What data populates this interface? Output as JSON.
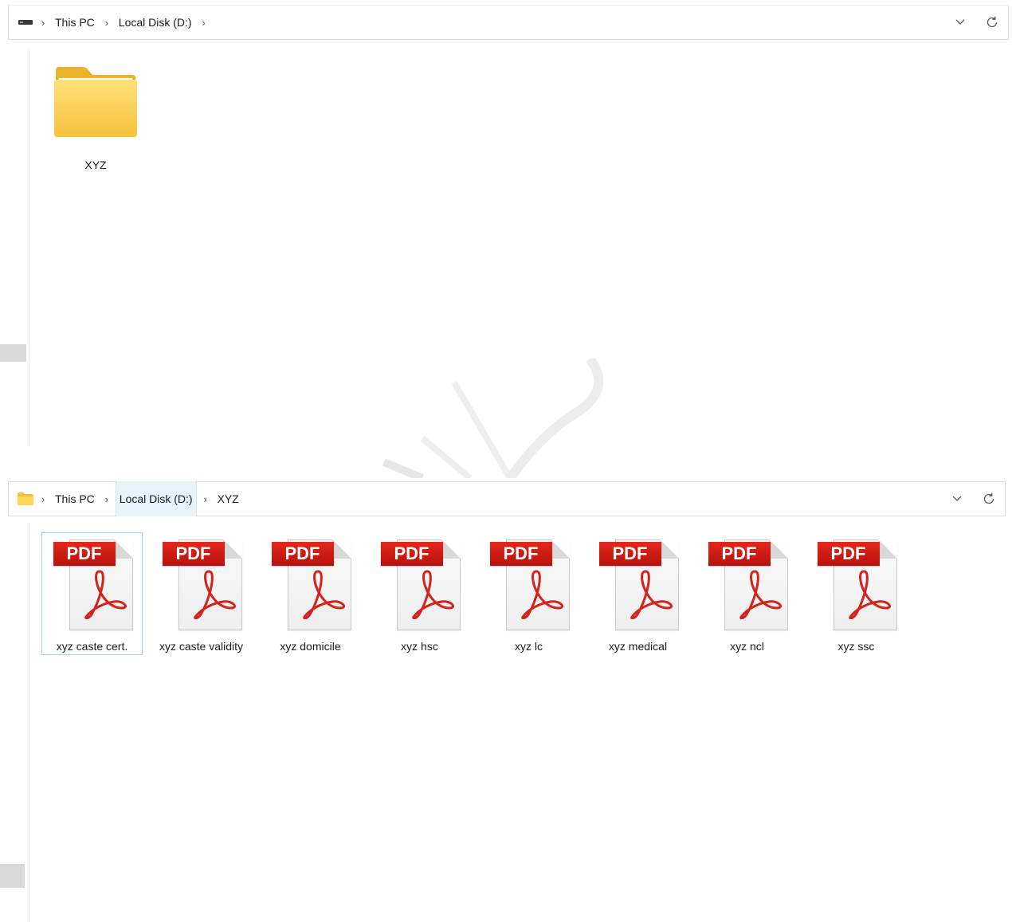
{
  "top_window": {
    "breadcrumb": [
      "This PC",
      "Local Disk (D:)"
    ],
    "items": [
      {
        "name": "XYZ",
        "type": "folder"
      }
    ]
  },
  "bottom_window": {
    "breadcrumb": [
      "This PC",
      "Local Disk (D:)",
      "XYZ"
    ],
    "items": [
      {
        "name": "xyz caste cert.",
        "type": "pdf",
        "selected": true
      },
      {
        "name": "xyz caste validity",
        "type": "pdf"
      },
      {
        "name": "xyz domicile",
        "type": "pdf"
      },
      {
        "name": "xyz hsc",
        "type": "pdf"
      },
      {
        "name": "xyz lc",
        "type": "pdf"
      },
      {
        "name": "xyz medical",
        "type": "pdf"
      },
      {
        "name": "xyz ncl",
        "type": "pdf"
      },
      {
        "name": "xyz ssc",
        "type": "pdf"
      }
    ]
  },
  "pdf_badge_text": "PDF",
  "icons": {
    "drive": "drive-icon",
    "folder": "folder-icon",
    "separator": "chevron-right-icon",
    "dropdown": "chevron-down-icon",
    "refresh": "refresh-icon",
    "pdf": "pdf-file-icon"
  },
  "colors": {
    "folder": "#F9C943",
    "pdf_red": "#D4231B",
    "selection_border": "#99D1FF",
    "active_crumb": "#E5F3FB"
  }
}
